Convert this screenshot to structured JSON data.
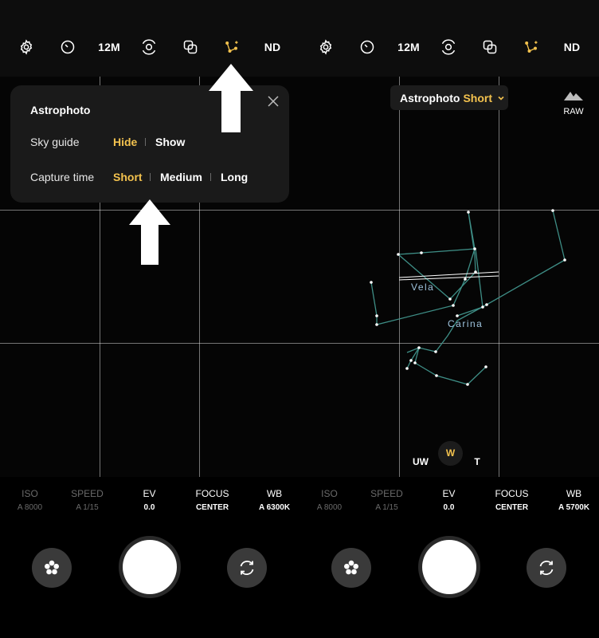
{
  "top_bar": {
    "resolution_label": "12M",
    "nd_label": "ND"
  },
  "popup": {
    "title": "Astrophoto",
    "sky_guide_label": "Sky guide",
    "sky_guide_options": [
      "Hide",
      "Show"
    ],
    "sky_guide_selected": "Hide",
    "capture_time_label": "Capture time",
    "capture_time_options": [
      "Short",
      "Medium",
      "Long"
    ],
    "capture_time_selected": "Short"
  },
  "mode_pill": {
    "mode": "Astrophoto",
    "duration": "Short"
  },
  "raw_label": "RAW",
  "constellations": [
    "Vela",
    "Carina"
  ],
  "zoom_levels": [
    "UW",
    "W",
    "T"
  ],
  "zoom_selected": "W",
  "left_settings": [
    {
      "label": "ISO",
      "value": "A 8000",
      "dim": true
    },
    {
      "label": "SPEED",
      "value": "A 1/15",
      "dim": true
    },
    {
      "label": "EV",
      "value": "0.0",
      "dim": false
    },
    {
      "label": "FOCUS",
      "value": "CENTER",
      "dim": false
    },
    {
      "label": "WB",
      "value": "A 6300K",
      "dim": false
    }
  ],
  "right_settings": [
    {
      "label": "ISO",
      "value": "A 8000",
      "dim": true
    },
    {
      "label": "SPEED",
      "value": "A 1/15",
      "dim": true
    },
    {
      "label": "EV",
      "value": "0.0",
      "dim": false
    },
    {
      "label": "FOCUS",
      "value": "CENTER",
      "dim": false
    },
    {
      "label": "WB",
      "value": "A 5700K",
      "dim": false
    }
  ],
  "colors": {
    "accent": "#f3c24e",
    "constellation_line": "#3e8e86",
    "constellation_text": "#9ec3dd"
  }
}
